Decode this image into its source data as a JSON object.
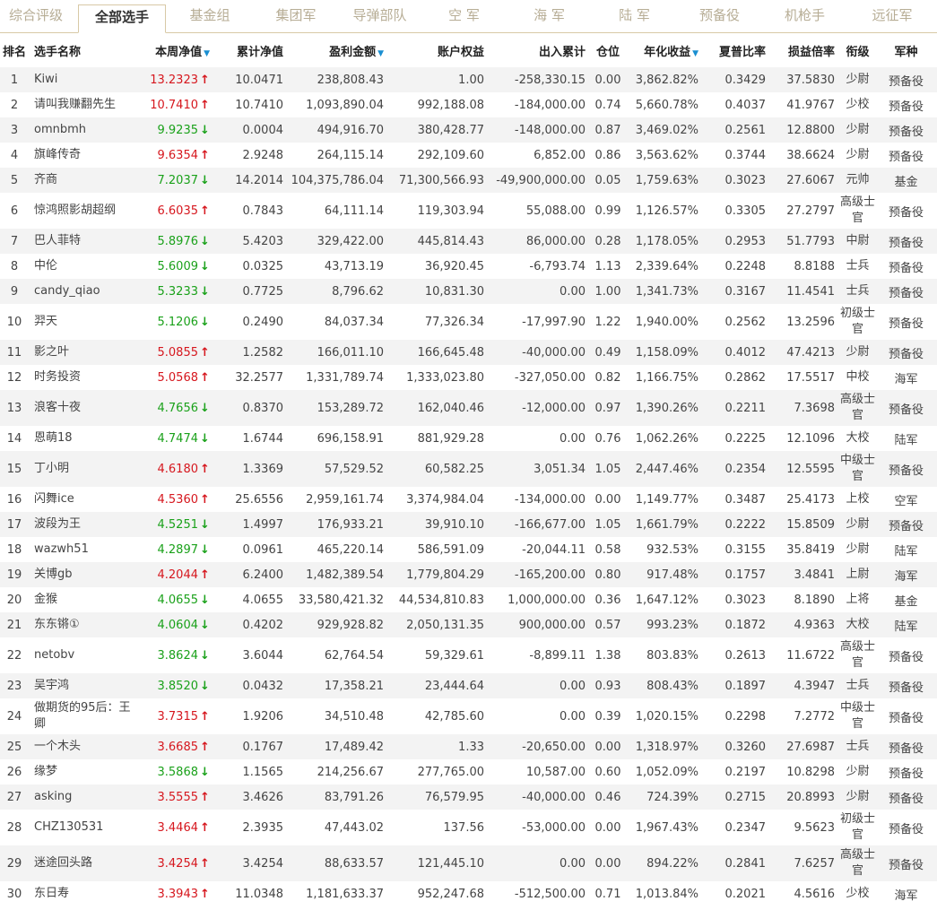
{
  "tabs": [
    "综合评级",
    "全部选手",
    "基金组",
    "集团军",
    "导弹部队",
    "空 军",
    "海 军",
    "陆 军",
    "预备役",
    "机枪手",
    "远征军"
  ],
  "active_tab": 1,
  "columns": [
    "排名",
    "选手名称",
    "本周净值",
    "累计净值",
    "盈利金额",
    "账户权益",
    "出入累计",
    "仓位",
    "年化收益",
    "夏普比率",
    "损益倍率",
    "衔级",
    "军种"
  ],
  "sort_icon": "▼",
  "rows": [
    {
      "rank": "1",
      "name": "Kiwi",
      "net": "13.2323",
      "dir": "up",
      "cum": "10.0471",
      "profit": "238,808.43",
      "equity": "1.00",
      "flow": "-258,330.15",
      "pos": "0.00",
      "annual": "3,862.82%",
      "sharpe": "0.3429",
      "ratio": "37.5830",
      "grade": "少尉",
      "branch": "预备役"
    },
    {
      "rank": "2",
      "name": "请叫我赚翻先生",
      "net": "10.7410",
      "dir": "up",
      "cum": "10.7410",
      "profit": "1,093,890.04",
      "equity": "992,188.08",
      "flow": "-184,000.00",
      "pos": "0.74",
      "annual": "5,660.78%",
      "sharpe": "0.4037",
      "ratio": "41.9767",
      "grade": "少校",
      "branch": "预备役"
    },
    {
      "rank": "3",
      "name": "omnbmh",
      "net": "9.9235",
      "dir": "down",
      "cum": "0.0004",
      "profit": "494,916.70",
      "equity": "380,428.77",
      "flow": "-148,000.00",
      "pos": "0.87",
      "annual": "3,469.02%",
      "sharpe": "0.2561",
      "ratio": "12.8800",
      "grade": "少尉",
      "branch": "预备役"
    },
    {
      "rank": "4",
      "name": "旗峰传奇",
      "net": "9.6354",
      "dir": "up",
      "cum": "2.9248",
      "profit": "264,115.14",
      "equity": "292,109.60",
      "flow": "6,852.00",
      "pos": "0.86",
      "annual": "3,563.62%",
      "sharpe": "0.3744",
      "ratio": "38.6624",
      "grade": "少尉",
      "branch": "预备役"
    },
    {
      "rank": "5",
      "name": "齐商",
      "net": "7.2037",
      "dir": "down",
      "cum": "14.2014",
      "profit": "104,375,786.04",
      "equity": "71,300,566.93",
      "flow": "-49,900,000.00",
      "pos": "0.05",
      "annual": "1,759.63%",
      "sharpe": "0.3023",
      "ratio": "27.6067",
      "grade": "元帅",
      "branch": "基金"
    },
    {
      "rank": "6",
      "name": "惊鸿照影胡超纲",
      "net": "6.6035",
      "dir": "up",
      "cum": "0.7843",
      "profit": "64,111.14",
      "equity": "119,303.94",
      "flow": "55,088.00",
      "pos": "0.99",
      "annual": "1,126.57%",
      "sharpe": "0.3305",
      "ratio": "27.2797",
      "grade": "高级士官",
      "branch": "预备役"
    },
    {
      "rank": "7",
      "name": "巴人菲特",
      "net": "5.8976",
      "dir": "down",
      "cum": "5.4203",
      "profit": "329,422.00",
      "equity": "445,814.43",
      "flow": "86,000.00",
      "pos": "0.28",
      "annual": "1,178.05%",
      "sharpe": "0.2953",
      "ratio": "51.7793",
      "grade": "中尉",
      "branch": "预备役"
    },
    {
      "rank": "8",
      "name": "中伦",
      "net": "5.6009",
      "dir": "down",
      "cum": "0.0325",
      "profit": "43,713.19",
      "equity": "36,920.45",
      "flow": "-6,793.74",
      "pos": "1.13",
      "annual": "2,339.64%",
      "sharpe": "0.2248",
      "ratio": "8.8188",
      "grade": "士兵",
      "branch": "预备役"
    },
    {
      "rank": "9",
      "name": "candy_qiao",
      "net": "5.3233",
      "dir": "down",
      "cum": "0.7725",
      "profit": "8,796.62",
      "equity": "10,831.30",
      "flow": "0.00",
      "pos": "1.00",
      "annual": "1,341.73%",
      "sharpe": "0.3167",
      "ratio": "11.4541",
      "grade": "士兵",
      "branch": "预备役"
    },
    {
      "rank": "10",
      "name": "羿天",
      "net": "5.1206",
      "dir": "down",
      "cum": "0.2490",
      "profit": "84,037.34",
      "equity": "77,326.34",
      "flow": "-17,997.90",
      "pos": "1.22",
      "annual": "1,940.00%",
      "sharpe": "0.2562",
      "ratio": "13.2596",
      "grade": "初级士官",
      "branch": "预备役"
    },
    {
      "rank": "11",
      "name": "影之叶",
      "net": "5.0855",
      "dir": "up",
      "cum": "1.2582",
      "profit": "166,011.10",
      "equity": "166,645.48",
      "flow": "-40,000.00",
      "pos": "0.49",
      "annual": "1,158.09%",
      "sharpe": "0.4012",
      "ratio": "47.4213",
      "grade": "少尉",
      "branch": "预备役"
    },
    {
      "rank": "12",
      "name": "时务投资",
      "net": "5.0568",
      "dir": "up",
      "cum": "32.2577",
      "profit": "1,331,789.74",
      "equity": "1,333,023.80",
      "flow": "-327,050.00",
      "pos": "0.82",
      "annual": "1,166.75%",
      "sharpe": "0.2862",
      "ratio": "17.5517",
      "grade": "中校",
      "branch": "海军"
    },
    {
      "rank": "13",
      "name": "浪客十夜",
      "net": "4.7656",
      "dir": "down",
      "cum": "0.8370",
      "profit": "153,289.72",
      "equity": "162,040.46",
      "flow": "-12,000.00",
      "pos": "0.97",
      "annual": "1,390.26%",
      "sharpe": "0.2211",
      "ratio": "7.3698",
      "grade": "高级士官",
      "branch": "预备役"
    },
    {
      "rank": "14",
      "name": "恩萌18",
      "net": "4.7474",
      "dir": "down",
      "cum": "1.6744",
      "profit": "696,158.91",
      "equity": "881,929.28",
      "flow": "0.00",
      "pos": "0.76",
      "annual": "1,062.26%",
      "sharpe": "0.2225",
      "ratio": "12.1096",
      "grade": "大校",
      "branch": "陆军"
    },
    {
      "rank": "15",
      "name": "丁小明",
      "net": "4.6180",
      "dir": "up",
      "cum": "1.3369",
      "profit": "57,529.52",
      "equity": "60,582.25",
      "flow": "3,051.34",
      "pos": "1.05",
      "annual": "2,447.46%",
      "sharpe": "0.2354",
      "ratio": "12.5595",
      "grade": "中级士官",
      "branch": "预备役"
    },
    {
      "rank": "16",
      "name": "闪舞ice",
      "net": "4.5360",
      "dir": "up",
      "cum": "25.6556",
      "profit": "2,959,161.74",
      "equity": "3,374,984.04",
      "flow": "-134,000.00",
      "pos": "0.00",
      "annual": "1,149.77%",
      "sharpe": "0.3487",
      "ratio": "25.4173",
      "grade": "上校",
      "branch": "空军"
    },
    {
      "rank": "17",
      "name": "波段为王",
      "net": "4.5251",
      "dir": "down",
      "cum": "1.4997",
      "profit": "176,933.21",
      "equity": "39,910.10",
      "flow": "-166,677.00",
      "pos": "1.05",
      "annual": "1,661.79%",
      "sharpe": "0.2222",
      "ratio": "15.8509",
      "grade": "少尉",
      "branch": "预备役"
    },
    {
      "rank": "18",
      "name": "wazwh51",
      "net": "4.2897",
      "dir": "down",
      "cum": "0.0961",
      "profit": "465,220.14",
      "equity": "586,591.09",
      "flow": "-20,044.11",
      "pos": "0.58",
      "annual": "932.53%",
      "sharpe": "0.3155",
      "ratio": "35.8419",
      "grade": "少尉",
      "branch": "陆军"
    },
    {
      "rank": "19",
      "name": "关博gb",
      "net": "4.2044",
      "dir": "up",
      "cum": "6.2400",
      "profit": "1,482,389.54",
      "equity": "1,779,804.29",
      "flow": "-165,200.00",
      "pos": "0.80",
      "annual": "917.48%",
      "sharpe": "0.1757",
      "ratio": "3.4841",
      "grade": "上尉",
      "branch": "海军"
    },
    {
      "rank": "20",
      "name": "金猴",
      "net": "4.0655",
      "dir": "down",
      "cum": "4.0655",
      "profit": "33,580,421.32",
      "equity": "44,534,810.83",
      "flow": "1,000,000.00",
      "pos": "0.36",
      "annual": "1,647.12%",
      "sharpe": "0.3023",
      "ratio": "8.1890",
      "grade": "上将",
      "branch": "基金"
    },
    {
      "rank": "21",
      "name": "东东锵①",
      "net": "4.0604",
      "dir": "down",
      "cum": "0.4202",
      "profit": "929,928.82",
      "equity": "2,050,131.35",
      "flow": "900,000.00",
      "pos": "0.57",
      "annual": "993.23%",
      "sharpe": "0.1872",
      "ratio": "4.9363",
      "grade": "大校",
      "branch": "陆军"
    },
    {
      "rank": "22",
      "name": "netobv",
      "net": "3.8624",
      "dir": "down",
      "cum": "3.6044",
      "profit": "62,764.54",
      "equity": "59,329.61",
      "flow": "-8,899.11",
      "pos": "1.38",
      "annual": "803.83%",
      "sharpe": "0.2613",
      "ratio": "11.6722",
      "grade": "高级士官",
      "branch": "预备役"
    },
    {
      "rank": "23",
      "name": "吴宇鸿",
      "net": "3.8520",
      "dir": "down",
      "cum": "0.0432",
      "profit": "17,358.21",
      "equity": "23,444.64",
      "flow": "0.00",
      "pos": "0.93",
      "annual": "808.43%",
      "sharpe": "0.1897",
      "ratio": "4.3947",
      "grade": "士兵",
      "branch": "预备役"
    },
    {
      "rank": "24",
      "name": "做期货的95后：王卿",
      "net": "3.7315",
      "dir": "up",
      "cum": "1.9206",
      "profit": "34,510.48",
      "equity": "42,785.60",
      "flow": "0.00",
      "pos": "0.39",
      "annual": "1,020.15%",
      "sharpe": "0.2298",
      "ratio": "7.2772",
      "grade": "中级士官",
      "branch": "预备役"
    },
    {
      "rank": "25",
      "name": "一个木头",
      "net": "3.6685",
      "dir": "up",
      "cum": "0.1767",
      "profit": "17,489.42",
      "equity": "1.33",
      "flow": "-20,650.00",
      "pos": "0.00",
      "annual": "1,318.97%",
      "sharpe": "0.3260",
      "ratio": "27.6987",
      "grade": "士兵",
      "branch": "预备役"
    },
    {
      "rank": "26",
      "name": "缘梦",
      "net": "3.5868",
      "dir": "down",
      "cum": "1.1565",
      "profit": "214,256.67",
      "equity": "277,765.00",
      "flow": "10,587.00",
      "pos": "0.60",
      "annual": "1,052.09%",
      "sharpe": "0.2197",
      "ratio": "10.8298",
      "grade": "少尉",
      "branch": "预备役"
    },
    {
      "rank": "27",
      "name": "asking",
      "net": "3.5555",
      "dir": "up",
      "cum": "3.4626",
      "profit": "83,791.26",
      "equity": "76,579.95",
      "flow": "-40,000.00",
      "pos": "0.46",
      "annual": "724.39%",
      "sharpe": "0.2715",
      "ratio": "20.8993",
      "grade": "少尉",
      "branch": "预备役"
    },
    {
      "rank": "28",
      "name": "CHZ130531",
      "net": "3.4464",
      "dir": "up",
      "cum": "2.3935",
      "profit": "47,443.02",
      "equity": "137.56",
      "flow": "-53,000.00",
      "pos": "0.00",
      "annual": "1,967.43%",
      "sharpe": "0.2347",
      "ratio": "9.5623",
      "grade": "初级士官",
      "branch": "预备役"
    },
    {
      "rank": "29",
      "name": "迷途回头路",
      "net": "3.4254",
      "dir": "up",
      "cum": "3.4254",
      "profit": "88,633.57",
      "equity": "121,445.10",
      "flow": "0.00",
      "pos": "0.00",
      "annual": "894.22%",
      "sharpe": "0.2841",
      "ratio": "7.6257",
      "grade": "高级士官",
      "branch": "预备役"
    },
    {
      "rank": "30",
      "name": "东日寿",
      "net": "3.3943",
      "dir": "up",
      "cum": "11.0348",
      "profit": "1,181,633.37",
      "equity": "952,247.68",
      "flow": "-512,500.00",
      "pos": "0.71",
      "annual": "1,013.84%",
      "sharpe": "0.2021",
      "ratio": "4.5616",
      "grade": "少校",
      "branch": "海军"
    }
  ]
}
